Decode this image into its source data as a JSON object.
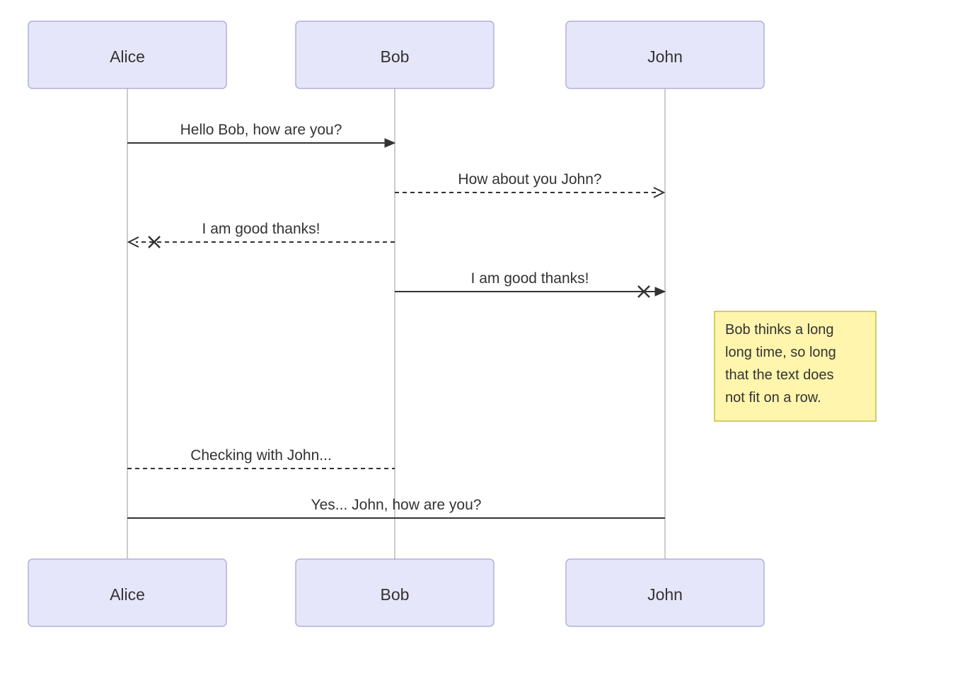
{
  "participants": {
    "alice": "Alice",
    "bob": "Bob",
    "john": "John"
  },
  "messages": {
    "m1": "Hello Bob, how are you?",
    "m2": "How about you John?",
    "m3": "I am good thanks!",
    "m4": "I am good thanks!",
    "m5": "Checking with John...",
    "m6": "Yes... John, how are you?"
  },
  "note": {
    "line1": "Bob thinks a long",
    "line2": "long time, so long",
    "line3": "that the text does",
    "line4": "not fit on a row."
  }
}
